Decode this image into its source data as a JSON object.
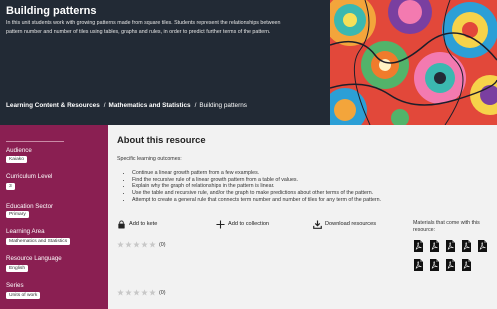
{
  "header": {
    "title": "Building patterns",
    "intro": "In this unit students work with growing patterns made from square tiles. Students represent the relationships between pattern number and number of tiles using tables, graphs and rules, in order to predict further terms of the pattern.",
    "breadcrumb": {
      "item1": "Learning Content & Resources",
      "item2": "Mathematics and Statistics",
      "current": "Building patterns",
      "separator": "/"
    }
  },
  "sidebar": {
    "audience_label": "Audience",
    "audience_value": "Kaiako",
    "curriculum_label": "Curriculum Level",
    "curriculum_value": "3",
    "sector_label": "Education Sector",
    "sector_value": "Primary",
    "learning_area_label": "Learning Area",
    "learning_area_value": "Mathematics and Statistics",
    "language_label": "Resource Language",
    "language_value": "English",
    "series_label": "Series",
    "series_value": "Units of work"
  },
  "main": {
    "section_title": "About this resource",
    "outcomes_heading": "Specific learning outcomes:",
    "outcomes": [
      "Continue a linear growth pattern from a few examples.",
      "Find the recursive rule of a linear growth pattern from a table of values.",
      "Explain why the graph of relationships in the pattern is linear.",
      "Use the table and recursive rule, and/or the graph to make predictions about other terms of the pattern.",
      "Attempt to create a general rule that connects term number and number of tiles for any term of the pattern."
    ],
    "actions": {
      "add_to_kete": "Add to kete",
      "add_to_collection": "Add to collection",
      "download": "Download resources"
    },
    "rating_count_1": "(0)",
    "rating_count_2": "(0)",
    "materials_label": "Materials that come with this resource:"
  },
  "icons": {
    "kete": "lock-bag-icon",
    "collection": "plus-icon",
    "download": "download-icon",
    "star": "star-icon",
    "pdf": "pdf-file-icon"
  },
  "colors": {
    "header_bg": "#222a35",
    "sidebar_bg": "#8a1f52",
    "main_bg": "#f2f2f2",
    "star_empty": "#c8c8c8"
  }
}
